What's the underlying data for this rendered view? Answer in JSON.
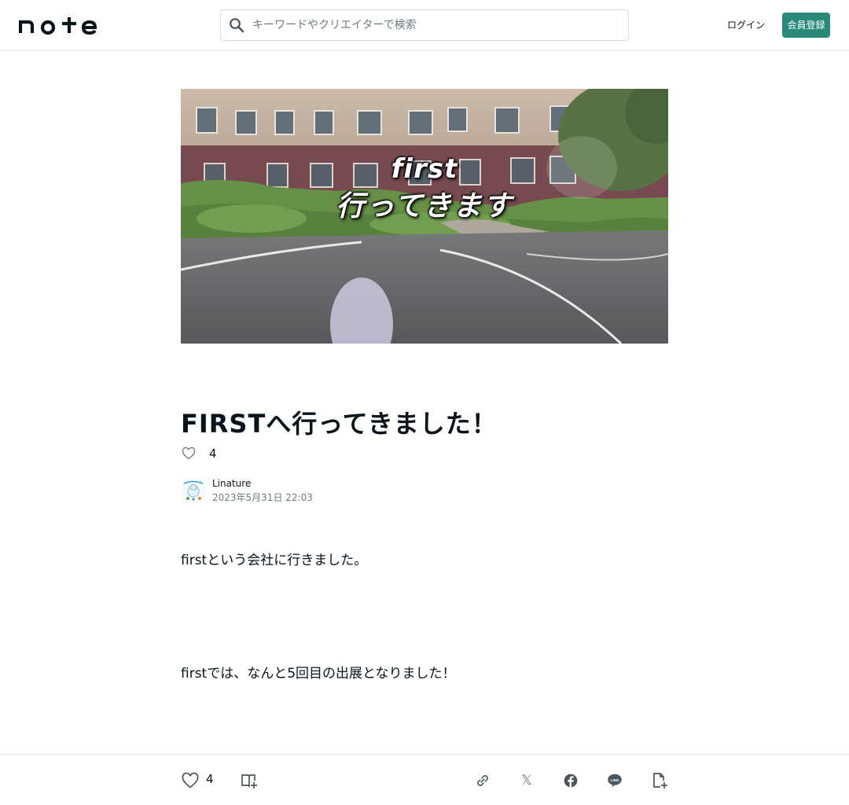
{
  "header": {
    "logo_text": "note",
    "search_placeholder": "キーワードやクリエイターで検索",
    "login_label": "ログイン",
    "signup_label": "会員登録"
  },
  "article": {
    "hero_caption_line1": "first",
    "hero_caption_line2": "行ってきます",
    "title": "FIRSTへ行ってきました！",
    "like_count": "4",
    "author_name": "Linature",
    "published": "2023年5月31日 22:03",
    "paragraphs": [
      "firstという会社に行きました。",
      "firstでは、なんと5回目の出展となりました！"
    ]
  },
  "bottom_bar": {
    "like_count": "4",
    "icons": [
      "heart-icon",
      "magazine-add-icon",
      "link-icon",
      "x-icon",
      "facebook-icon",
      "line-icon",
      "note-add-icon"
    ]
  },
  "colors": {
    "accent": "#2a8a7a",
    "text": "#08131a",
    "muted": "#6e7a80",
    "border": "#e6e6e6"
  }
}
